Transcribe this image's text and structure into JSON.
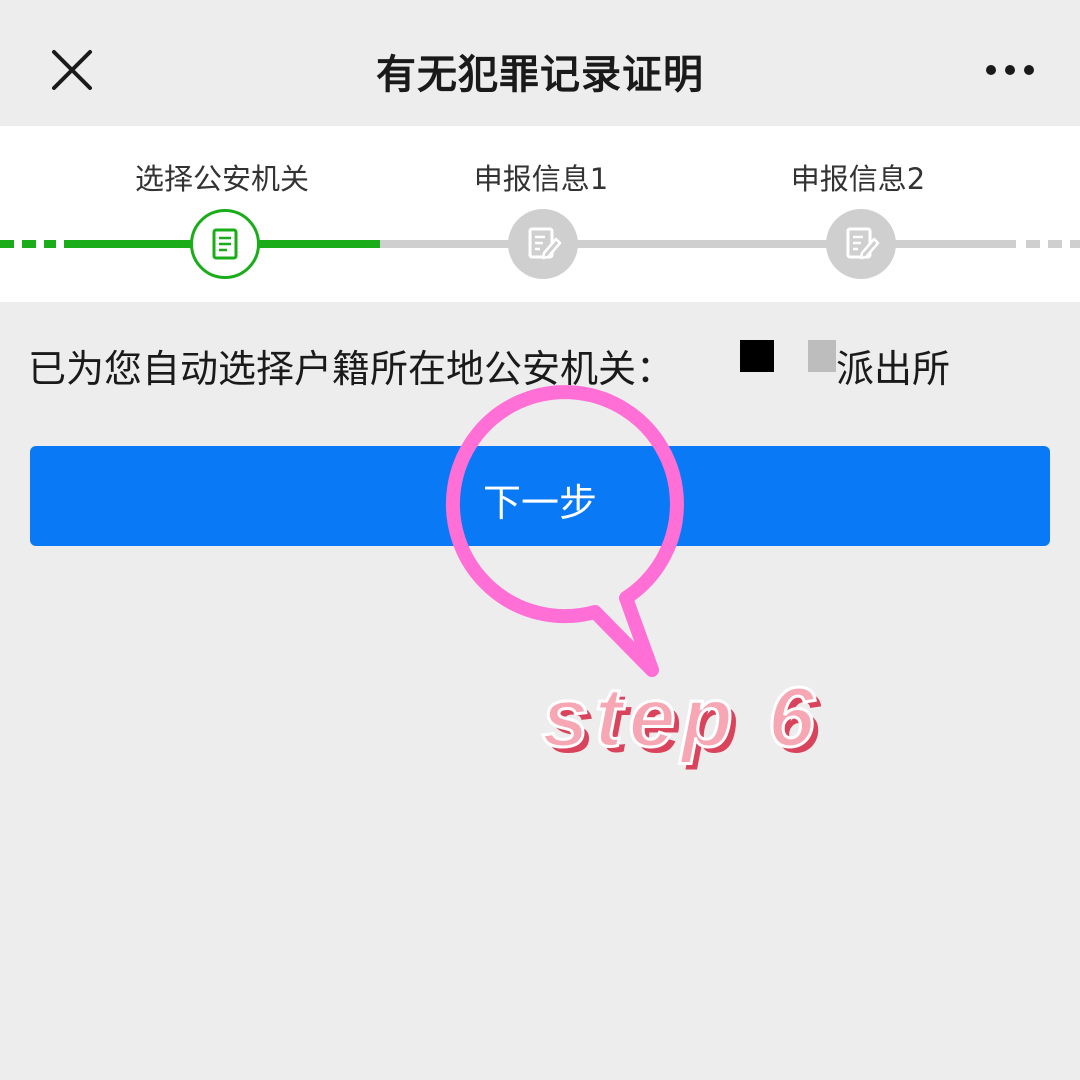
{
  "header": {
    "title": "有无犯罪记录证明",
    "close_icon": "close-icon",
    "more_icon": "more-horizontal-icon"
  },
  "steps": [
    {
      "label": "选择公安机关",
      "state": "active",
      "icon": "document-icon"
    },
    {
      "label": "申报信息1",
      "state": "pending",
      "icon": "edit-document-icon"
    },
    {
      "label": "申报信息2",
      "state": "pending",
      "icon": "edit-document-icon"
    }
  ],
  "info": {
    "prefix": "已为您自动选择户籍所在地公安机关：",
    "suffix": "派出所"
  },
  "next_button": {
    "label": "下一步"
  },
  "annotation": {
    "text": "step 6"
  },
  "colors": {
    "accent_green": "#1aad19",
    "primary_blue": "#0a79f6",
    "annotation_pink": "#ff6fd6",
    "inactive_gray": "#cfcfcf"
  }
}
